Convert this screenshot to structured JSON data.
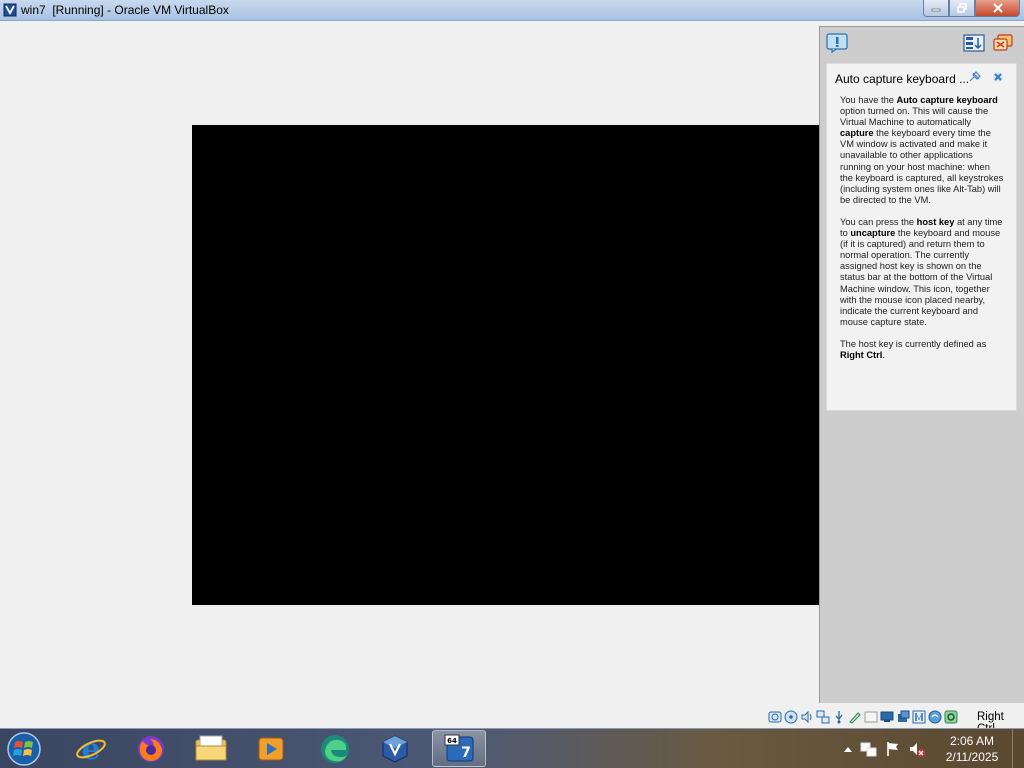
{
  "window": {
    "title": "win7  [Running] - Oracle VM VirtualBox",
    "buttons": [
      "minimize-icon",
      "restore-icon",
      "close-icon"
    ]
  },
  "notification_panel": {
    "top_icons": [
      "help-icon",
      "panel-options-icon",
      "pin-notifications-icon"
    ],
    "notification": {
      "title": "Auto capture keyboard ...",
      "para1": {
        "t1": "You have the ",
        "b1": "Auto capture keyboard",
        "t2": " option turned on. This will cause the Virtual Machine to automatically ",
        "b2": "capture",
        "t3": " the keyboard every time the VM window is activated and make it unavailable to other applications running on your host machine: when the keyboard is captured, all keystrokes (including system ones like Alt-Tab) will be directed to the VM."
      },
      "para2": {
        "t1": "You can press the ",
        "b1": "host key",
        "t2": " at any time to ",
        "b2": "uncapture",
        "t3": " the keyboard and mouse (if it is captured) and return them to normal operation. The currently assigned host key is shown on the status bar at the bottom of the Virtual Machine window. This icon, together with the mouse icon placed nearby, indicate the current keyboard and mouse capture state."
      },
      "para3": {
        "t1": "The host key is currently defined as ",
        "b1": "Right Ctrl",
        "t2": "."
      }
    }
  },
  "status_bar": {
    "icons": [
      "hard-disk-icon",
      "optical-drive-icon",
      "audio-icon",
      "network-icon",
      "usb-icon",
      "shared-folders-icon",
      "display-icon",
      "recording-icon",
      "cpu-icon",
      "mouse-integration-icon",
      "keyboard-capture-icon"
    ],
    "host_key": "Right Ctrl"
  },
  "taskbar": {
    "pinned": [
      "internet-explorer-icon",
      "firefox-icon",
      "file-explorer-icon",
      "media-player-icon",
      "edge-icon",
      "virtualbox-icon",
      "virtualbox-vm-win7-icon"
    ],
    "active_index": 6,
    "vm_badge": "64",
    "vm_number": "7",
    "tray": [
      "show-hidden-icons-icon",
      "network-tray-icon",
      "action-center-flag-icon",
      "volume-muted-icon"
    ],
    "time": "2:06 AM",
    "date": "2/11/2025"
  }
}
